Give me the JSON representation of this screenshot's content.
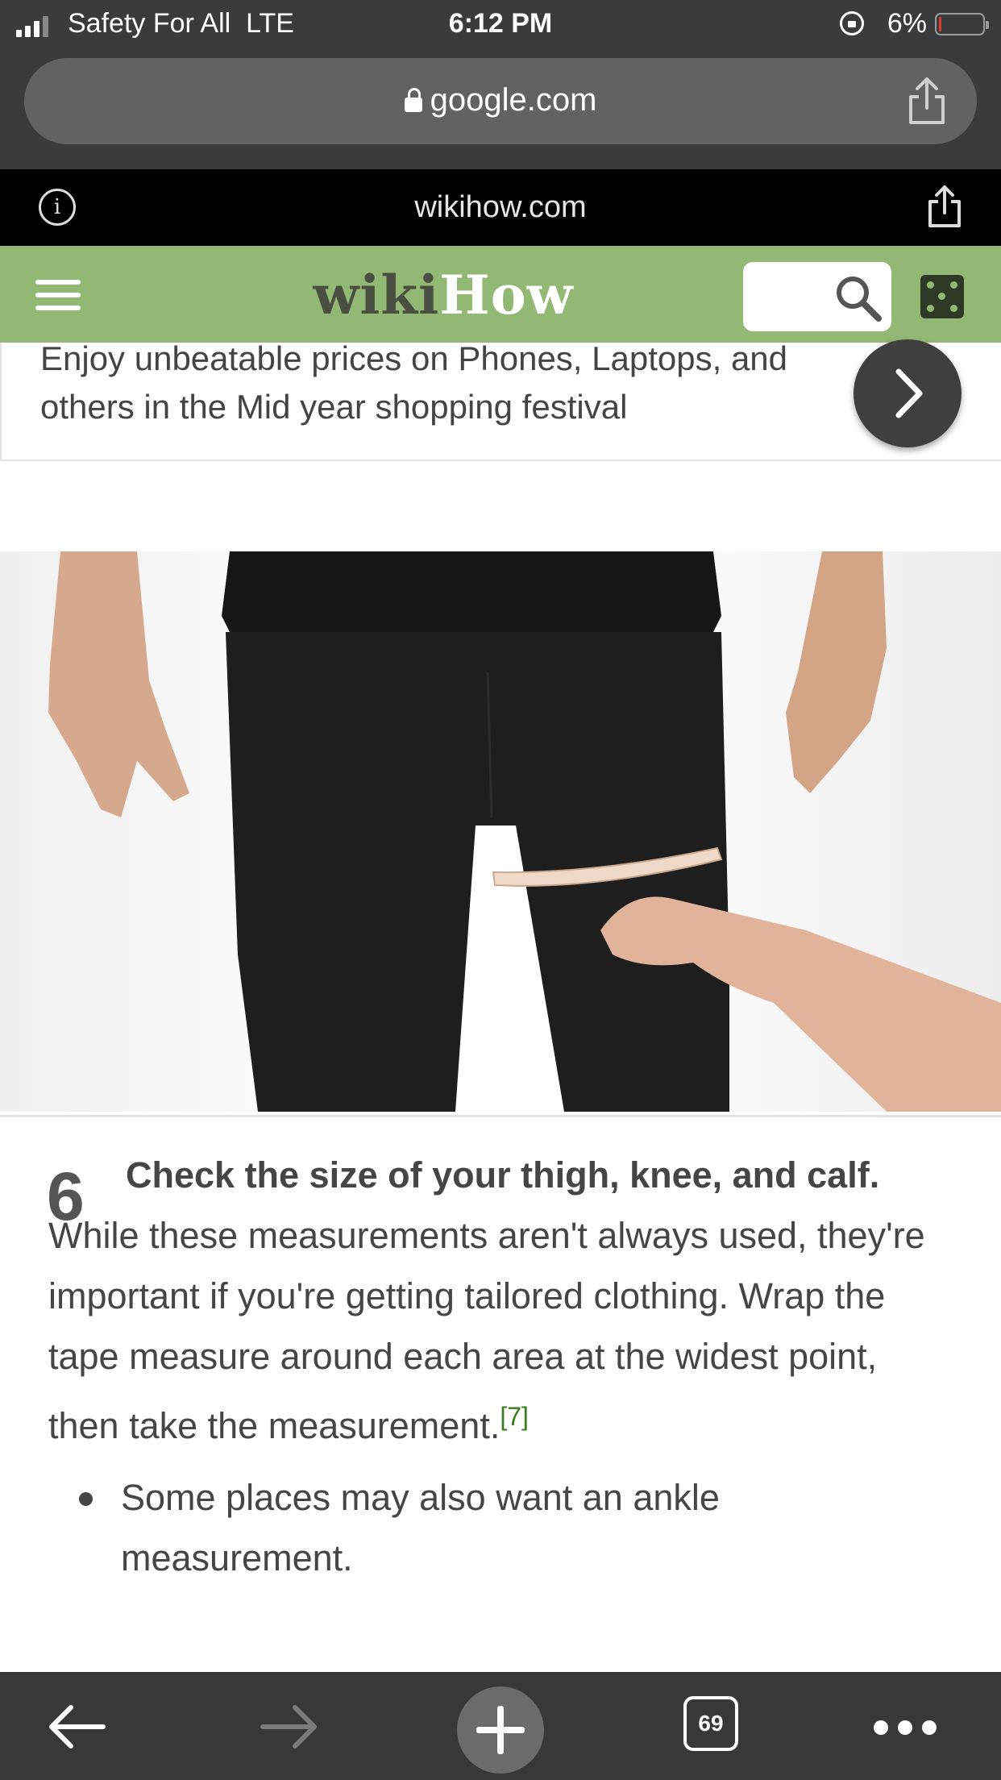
{
  "status_bar": {
    "carrier": "Safety For All",
    "network": "LTE",
    "time": "6:12 PM",
    "battery_pct": "6%",
    "battery_level": 0.06,
    "battery_color": "#e53935"
  },
  "browser": {
    "url_host": "google.com",
    "site_domain": "wikihow.com",
    "tabs_count": "69"
  },
  "wikihow_header": {
    "logo_part1": "wiki",
    "logo_part2": "How",
    "brand_color": "#93b874"
  },
  "ad": {
    "text": "Enjoy unbeatable prices on Phones, Laptops, and others in the Mid year shopping festival"
  },
  "step": {
    "number": "6",
    "title": "Check the size of your thigh, knee, and calf.",
    "body": "While these measurements aren't always used, they're important if you're getting tailored clothing. Wrap the tape measure around each area at the widest point, then take the measurement.",
    "citation": "[7]",
    "bullets": [
      "Some places may also want an ankle measurement."
    ]
  },
  "icons": {
    "back": "back-arrow-icon",
    "forward": "forward-arrow-icon",
    "new_tab": "plus-icon",
    "tabs": "tabs-count-icon",
    "more": "more-icon",
    "share": "share-icon",
    "info": "info-icon",
    "search": "search-icon",
    "random": "dice-icon",
    "menu": "hamburger-icon"
  }
}
